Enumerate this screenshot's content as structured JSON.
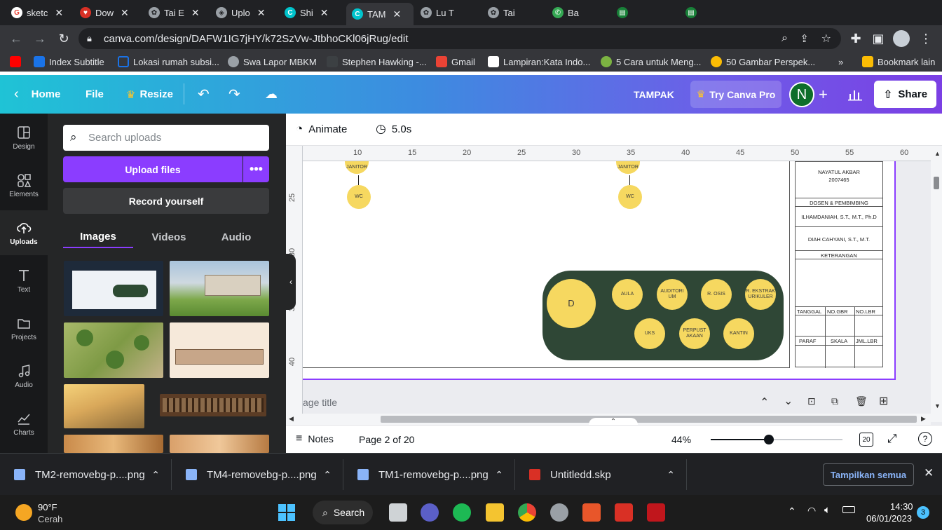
{
  "browser": {
    "tabs": [
      {
        "label": "sketc",
        "color": "#ea4335"
      },
      {
        "label": "Dow",
        "color": "#d93025"
      },
      {
        "label": "Tai E",
        "color": "#9aa0a6"
      },
      {
        "label": "Uplo",
        "color": "#9aa0a6"
      },
      {
        "label": "Shi",
        "color": "#00c4cc"
      },
      {
        "label": "TAM",
        "color": "#00c4cc"
      },
      {
        "label": "Lu T",
        "color": "#9aa0a6"
      },
      {
        "label": "Tai",
        "color": "#9aa0a6"
      },
      {
        "label": "Ba",
        "color": "#34a853"
      },
      {
        "label": "",
        "color": "#188038"
      },
      {
        "label": "",
        "color": "#188038"
      }
    ],
    "url": "canva.com/design/DAFW1IG7jHY/k72SzVw-JtbhoCKl06jRug/edit",
    "bookmarks": [
      {
        "label": "",
        "color": "#ff0000"
      },
      {
        "label": "Index Subtitle",
        "color": "#1a73e8"
      },
      {
        "label": "Lokasi rumah subsi...",
        "color": "#1a73e8"
      },
      {
        "label": "Swa Lapor MBKM",
        "color": "#9aa0a6"
      },
      {
        "label": "Stephen Hawking -...",
        "color": "#3c4043"
      },
      {
        "label": "Gmail",
        "color": "#ea4335"
      },
      {
        "label": "Lampiran:Kata Indo...",
        "color": "#ffffff"
      },
      {
        "label": "5 Cara untuk Meng...",
        "color": "#7cb342"
      },
      {
        "label": "50 Gambar Perspek...",
        "color": "#fbbc04"
      }
    ],
    "bookmark_more": "»",
    "bookmark_other": "Bookmark lain"
  },
  "canva": {
    "home": "Home",
    "file": "File",
    "resize": "Resize",
    "design_title": "TAMPAK",
    "try_pro": "Try Canva Pro",
    "avatar_letter": "N",
    "share": "Share",
    "rail": [
      "Design",
      "Elements",
      "Uploads",
      "Text",
      "Projects",
      "Audio",
      "Charts"
    ],
    "search_placeholder": "Search uploads",
    "upload_files": "Upload files",
    "more": "•••",
    "record": "Record yourself",
    "panel_tabs": [
      "Images",
      "Videos",
      "Audio"
    ],
    "animate": "Animate",
    "duration": "5.0s",
    "ruler_top": [
      "10",
      "15",
      "20",
      "25",
      "30",
      "35",
      "40",
      "45",
      "50",
      "55",
      "60"
    ],
    "ruler_left": [
      "25",
      "30",
      "35",
      "40"
    ],
    "page_title_placeholder": "age title",
    "notes": "Notes",
    "page_indicator": "Page 2 of 20",
    "zoom": "44%",
    "zoom_fraction": 0.44,
    "grid_count": "20"
  },
  "drawing": {
    "janitor": "JANITOR",
    "wc": "WC",
    "center": "D",
    "rooms": [
      "AULA",
      "AUDITORI UM",
      "R. OSIS",
      "R. EKSTRAK URIKULER",
      "UKS",
      "PERPUST AKAAN",
      "KANTIN"
    ],
    "title_block": {
      "name": "NAYATUL AKBAR",
      "nim": "2007465",
      "dosen_label": "DOSEN & PEMBIMBING",
      "dosen1": "ILHAMDANIAH, S.T., M.T., Ph.D",
      "dosen2": "DIAH CAHYANI, S.T., M.T.",
      "keterangan": "KETERANGAN",
      "row1": [
        "TANGGAL",
        "NO.GBR",
        "NO.LBR"
      ],
      "row2": [
        "PARAF",
        "SKALA",
        "JML.LBR"
      ]
    }
  },
  "downloads": {
    "items": [
      "TM2-removebg-p....png",
      "TM4-removebg-p....png",
      "TM1-removebg-p....png",
      "Untitledd.skp"
    ],
    "show_all": "Tampilkan semua"
  },
  "taskbar": {
    "temp": "90°F",
    "weather": "Cerah",
    "search": "Search",
    "time": "14:30",
    "date": "06/01/2023",
    "notif": "3"
  }
}
